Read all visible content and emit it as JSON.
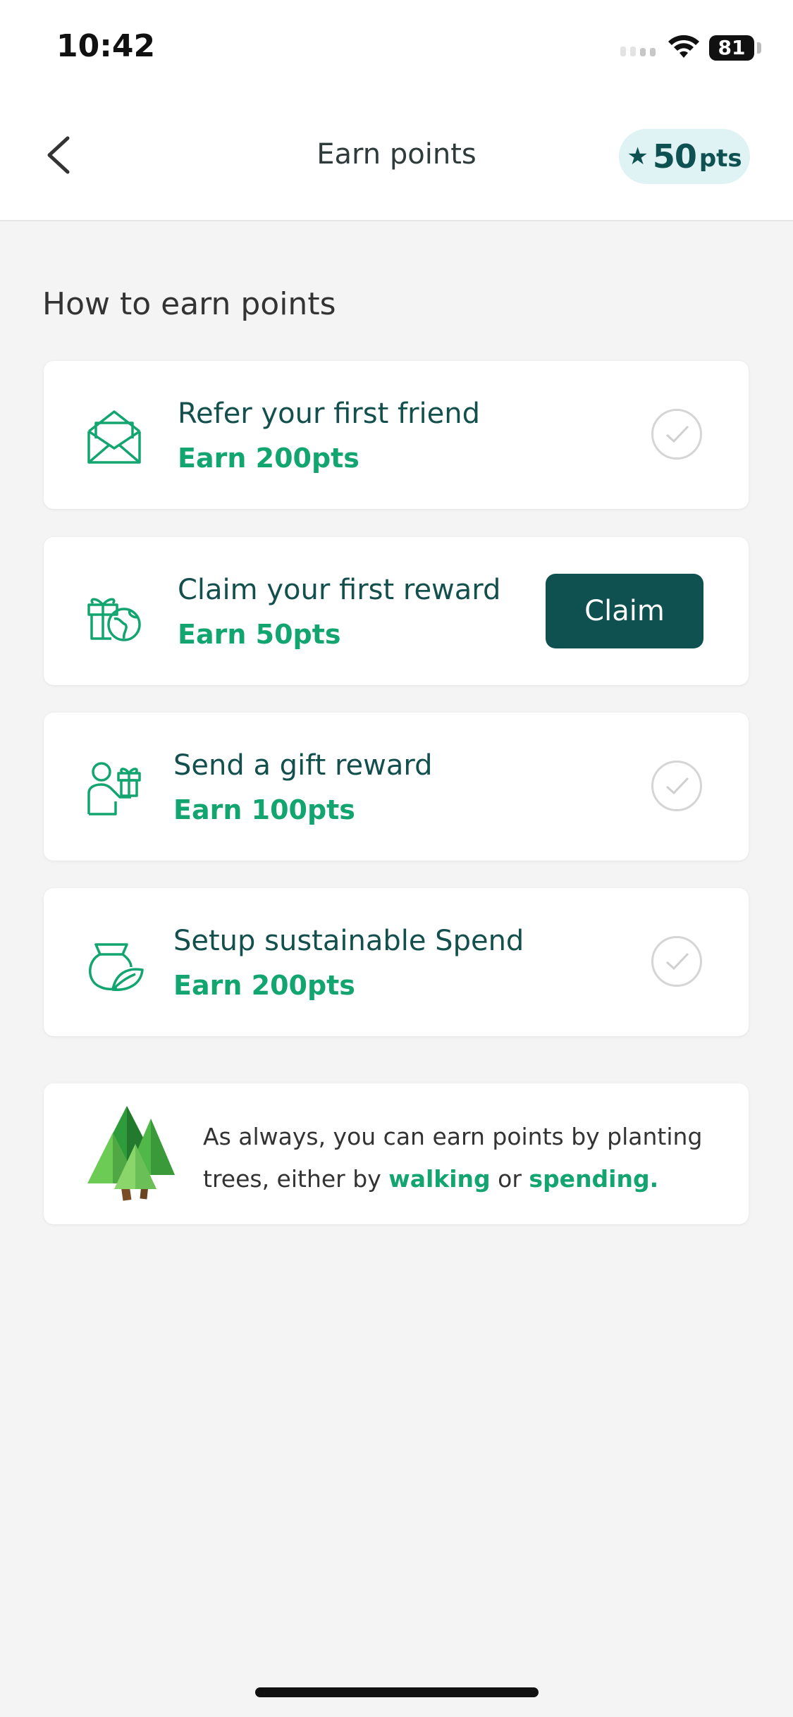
{
  "status_bar": {
    "time": "10:42",
    "battery": "81"
  },
  "nav": {
    "title": "Earn points",
    "points_value": "50",
    "points_unit": "pts",
    "star_icon": "★"
  },
  "section_title": "How to earn points",
  "tasks": [
    {
      "icon": "envelope-icon",
      "title": "Refer your first friend",
      "earn": "Earn 200pts",
      "state": "unchecked"
    },
    {
      "icon": "gift-globe-icon",
      "title": "Claim your first reward",
      "earn": "Earn 50pts",
      "state": "claimable",
      "action_label": "Claim"
    },
    {
      "icon": "person-gift-icon",
      "title": "Send a gift reward",
      "earn": "Earn 100pts",
      "state": "unchecked"
    },
    {
      "icon": "leaf-pot-icon",
      "title": "Setup sustainable Spend",
      "earn": "Earn 200pts",
      "state": "unchecked"
    }
  ],
  "info": {
    "text_before": "As always, you can earn points by planting trees, either by ",
    "link_walking": "walking",
    "text_middle": " or ",
    "link_spending": "spending."
  },
  "colors": {
    "accent": "#13a56f",
    "brand_dark": "#0f5151",
    "pill_bg": "#dff2f4"
  }
}
